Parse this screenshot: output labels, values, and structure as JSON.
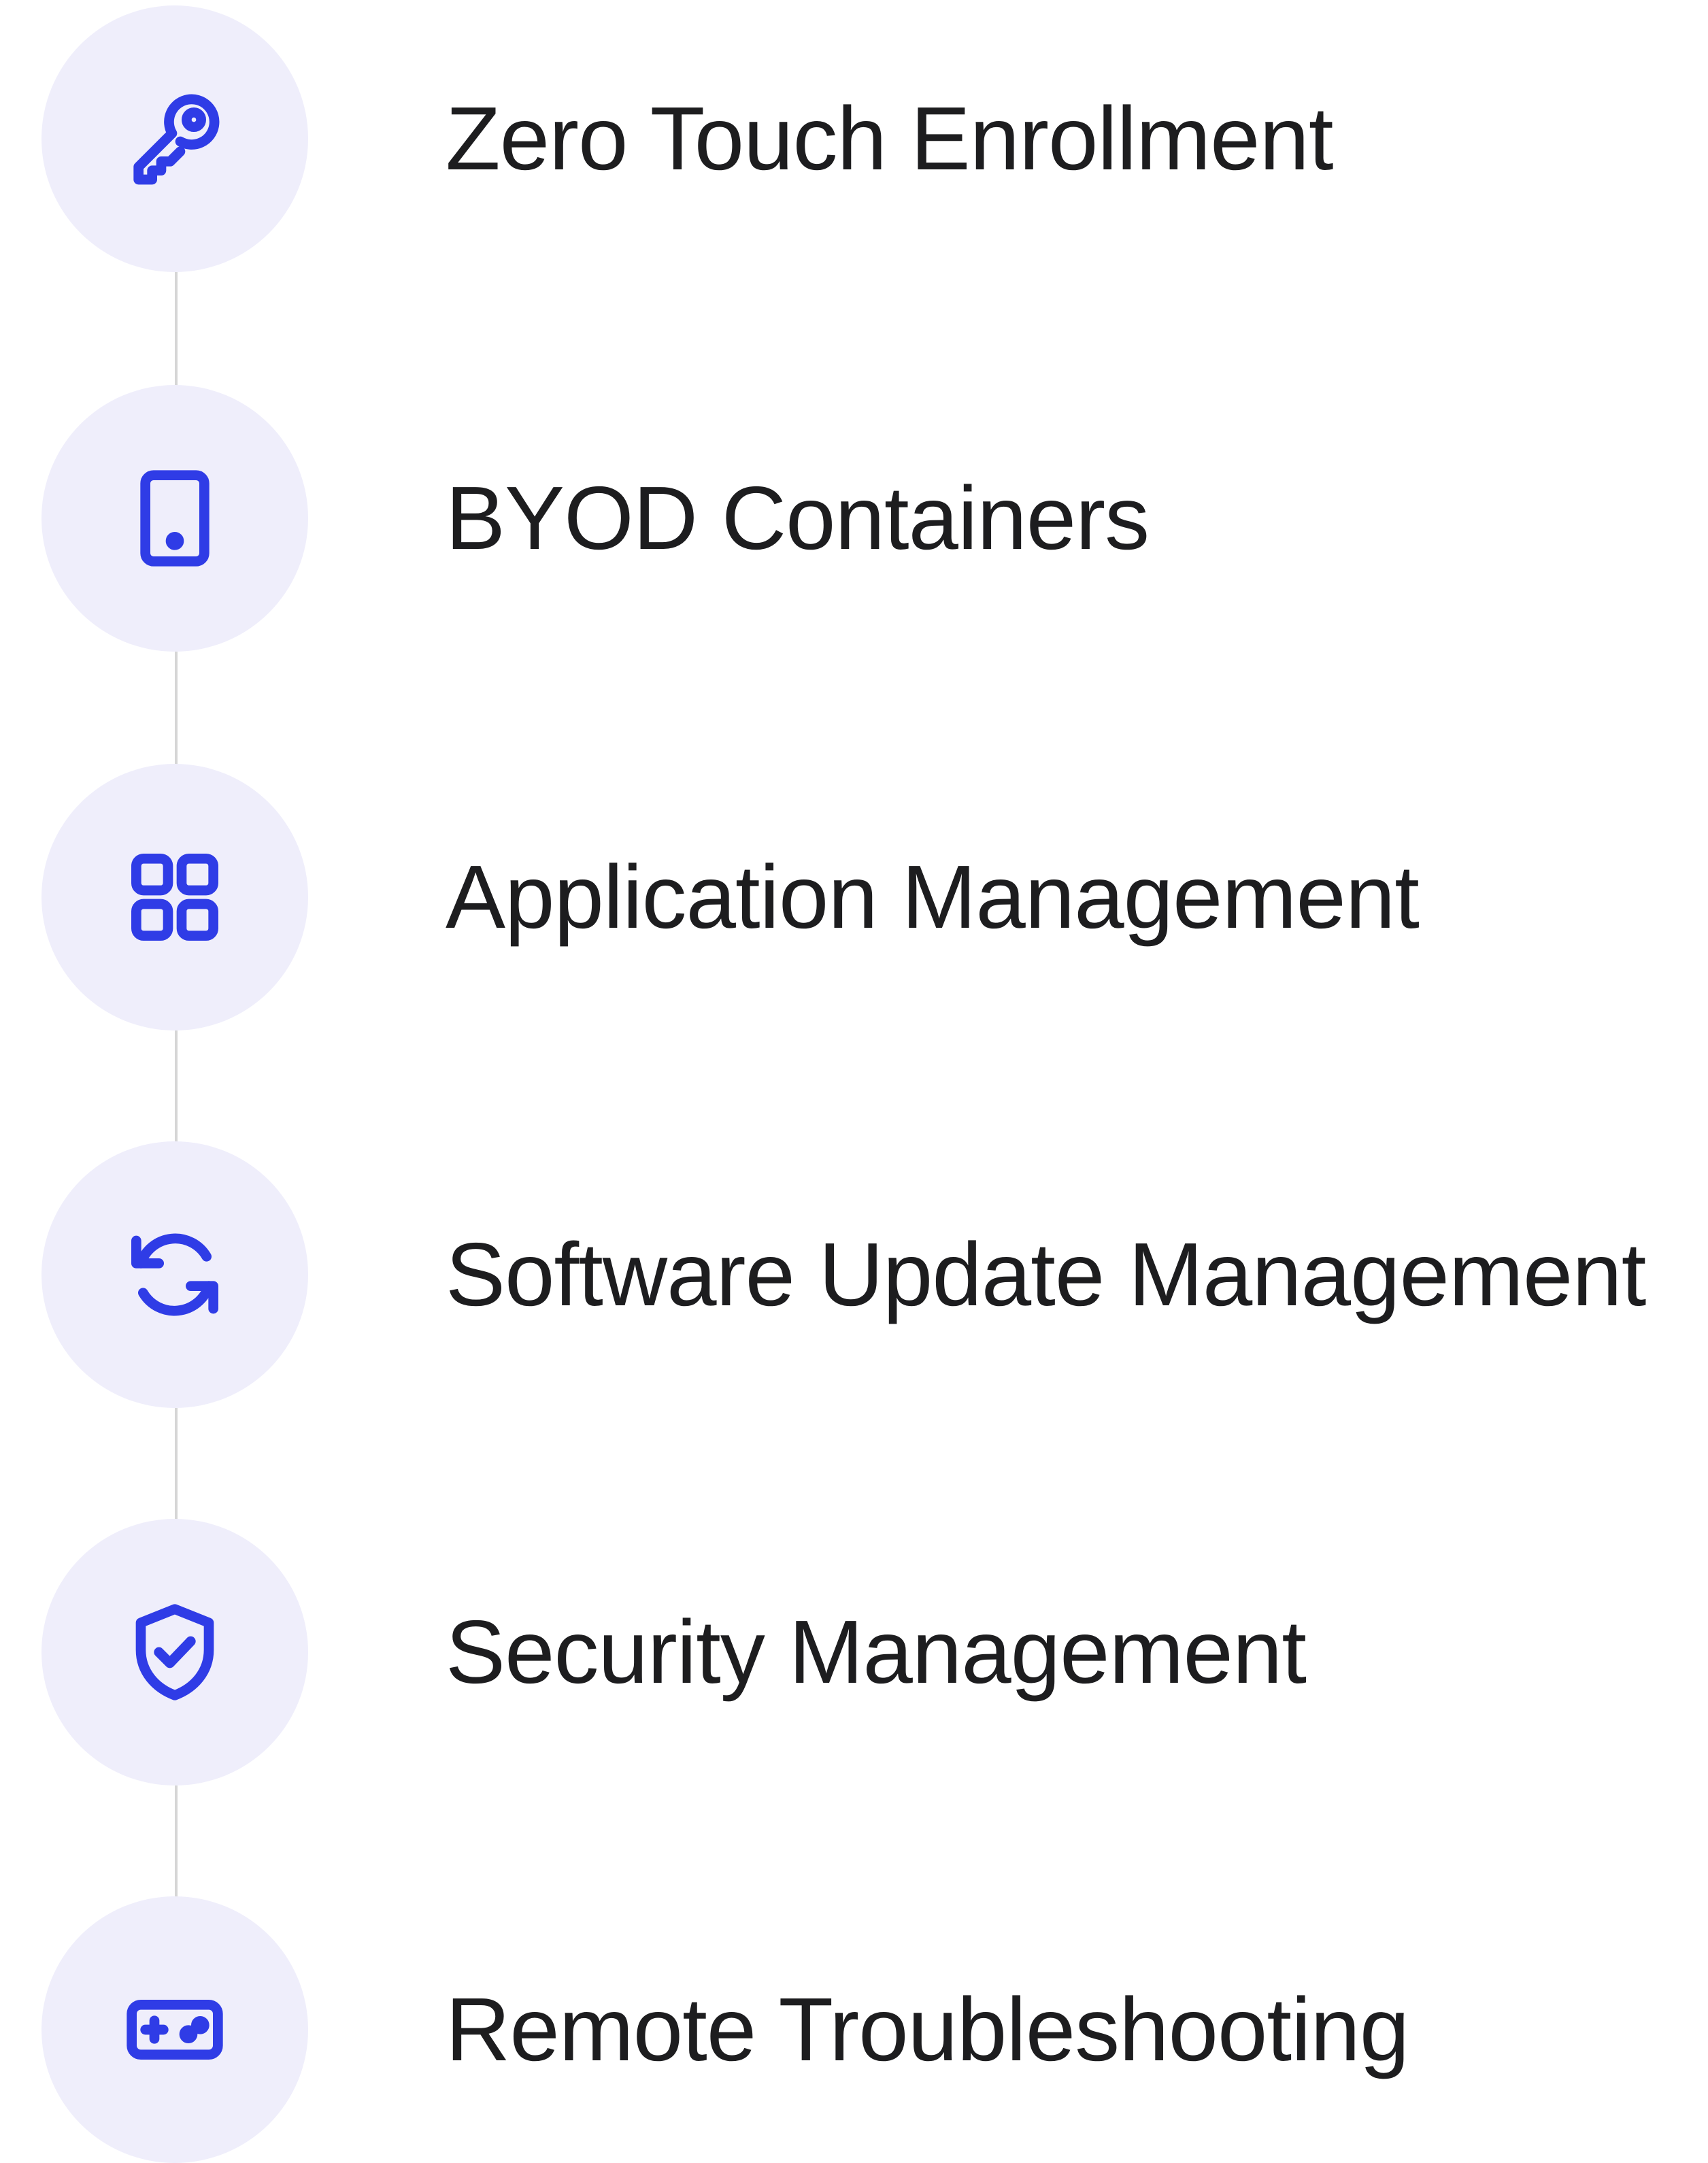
{
  "colors": {
    "accent": "#2f3ce6",
    "circle_bg": "#efeefb",
    "connector": "#d6d6d6",
    "text": "#1d1d1f"
  },
  "features": [
    {
      "label": "Zero Touch Enrollment",
      "icon": "key-icon"
    },
    {
      "label": "BYOD Containers",
      "icon": "tablet-icon"
    },
    {
      "label": "Application Management",
      "icon": "app-grid-icon"
    },
    {
      "label": "Software Update Management",
      "icon": "refresh-icon"
    },
    {
      "label": "Security Management",
      "icon": "shield-check-icon"
    },
    {
      "label": "Remote Troubleshooting",
      "icon": "gamepad-icon"
    }
  ]
}
